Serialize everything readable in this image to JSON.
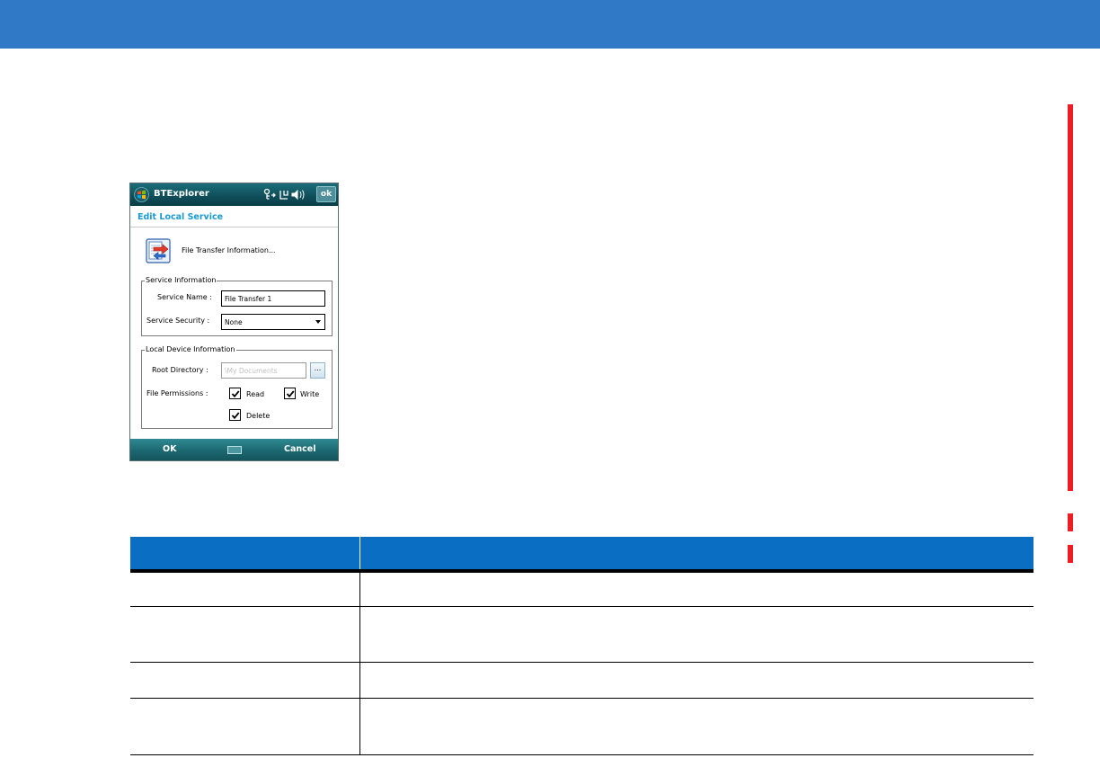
{
  "colors": {
    "top_band": "#2f79c6",
    "change_bar": "#ee1c25",
    "table_header": "#0a6fc2",
    "device_title_bar": "#0f4d58",
    "device_header_text": "#1a9bd0"
  },
  "device": {
    "title_bar": {
      "app_name": "BTExplorer",
      "ok_label": "ok",
      "start_icon": "windows-flag-icon",
      "status_icons": [
        "bluetooth-icon",
        "connectivity-icon",
        "volume-icon"
      ]
    },
    "header": "Edit Local Service",
    "service_title": "File Transfer Information...",
    "service_icon": "file-transfer-icon",
    "service_info": {
      "group_label": "Service Information",
      "name_label": "Service Name :",
      "name_value": "File Transfer 1",
      "security_label": "Service Security :",
      "security_value": "None"
    },
    "local_device": {
      "group_label": "Local Device Information",
      "root_label": "Root Directory :",
      "root_value": "\\My Documents",
      "browse_label": "...",
      "permissions_label": "File Permissions :",
      "permissions": [
        {
          "label": "Read",
          "checked": true
        },
        {
          "label": "Write",
          "checked": true
        },
        {
          "label": "Delete",
          "checked": true
        }
      ]
    },
    "softkeys": {
      "left": "OK",
      "right": "Cancel",
      "center_icon": "keyboard-icon"
    }
  },
  "table": {
    "headers": [
      "",
      ""
    ],
    "rows": [
      [
        "",
        ""
      ],
      [
        "",
        ""
      ],
      [
        "",
        ""
      ],
      [
        "",
        ""
      ]
    ]
  }
}
